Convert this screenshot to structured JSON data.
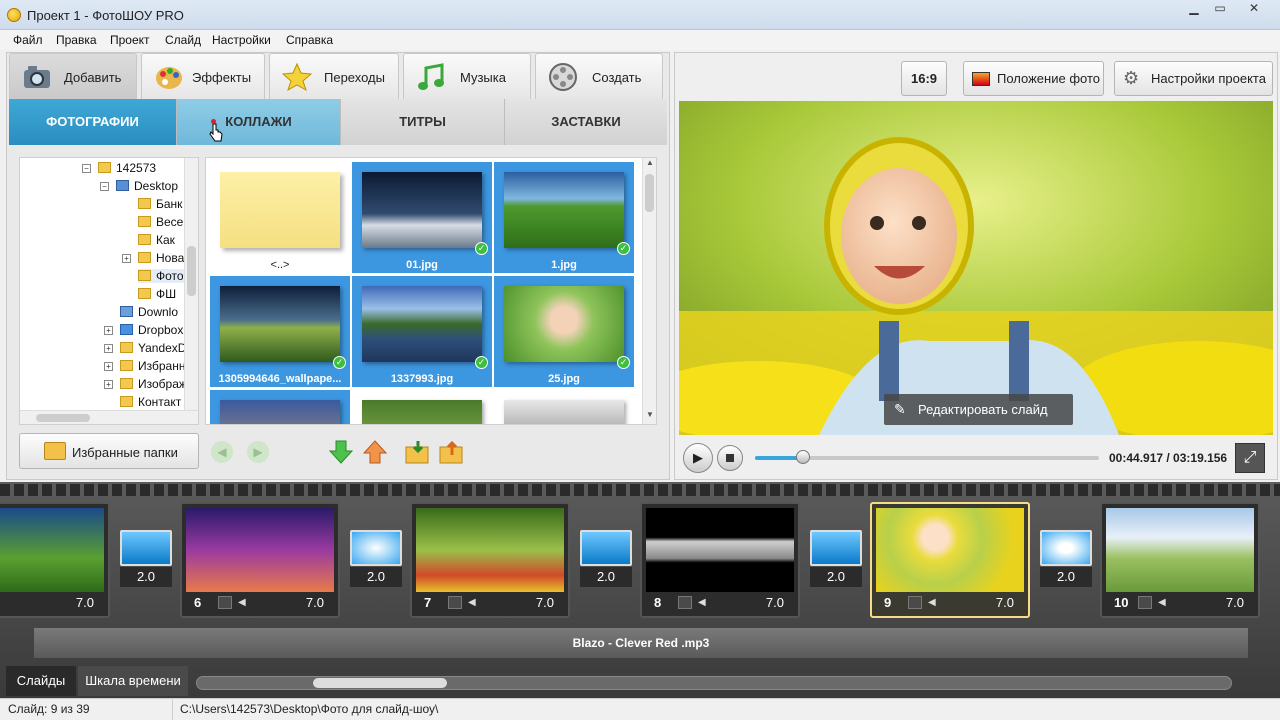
{
  "window": {
    "title": "Проект 1 - ФотоШОУ PRO",
    "min": "▁",
    "max": "▭",
    "close": "✕"
  },
  "menu": [
    "Файл",
    "Правка",
    "Проект",
    "Слайд",
    "Настройки",
    "Справка"
  ],
  "main_tabs": [
    "Добавить",
    "Эффекты",
    "Переходы",
    "Музыка",
    "Создать"
  ],
  "sub_tabs": [
    "ФОТОГРАФИИ",
    "КОЛЛАЖИ",
    "ТИТРЫ",
    "ЗАСТАВКИ"
  ],
  "tree": {
    "nodes": [
      "142573",
      "Desktop",
      "Банк",
      "Весе",
      "Как",
      "Нова",
      "Фото",
      "ФШ",
      "Downlo",
      "Dropbox",
      "YandexD",
      "Избранн",
      "Изображ",
      "Контакт"
    ]
  },
  "files": [
    {
      "name": "<..>"
    },
    {
      "name": "01.jpg"
    },
    {
      "name": "1.jpg"
    },
    {
      "name": "1305994646_wallpape..."
    },
    {
      "name": "1337993.jpg"
    },
    {
      "name": "25.jpg"
    }
  ],
  "fav_button": "Избранные папки",
  "right": {
    "ratio": "16:9",
    "photo_pos": "Положение фото",
    "project_settings": "Настройки проекта",
    "edit_slide": "Редактировать слайд",
    "time": "00:44.917 / 03:19.156",
    "progress": 0.14
  },
  "slides": [
    {
      "num": "",
      "dur": "7.0"
    },
    {
      "num": "6",
      "dur": "7.0"
    },
    {
      "num": "7",
      "dur": "7.0"
    },
    {
      "num": "8",
      "dur": "7.0"
    },
    {
      "num": "9",
      "dur": "7.0"
    },
    {
      "num": "10",
      "dur": "7.0"
    }
  ],
  "transitions": [
    "2.0",
    "2.0",
    "2.0",
    "2.0",
    "2.0"
  ],
  "audio_track": "Blazo - Clever Red .mp3",
  "bottom_tabs": [
    "Слайды",
    "Шкала времени"
  ],
  "status": {
    "slide": "Слайд: 9 из 39",
    "path": "C:\\Users\\142573\\Desktop\\Фото для слайд-шоу\\"
  }
}
